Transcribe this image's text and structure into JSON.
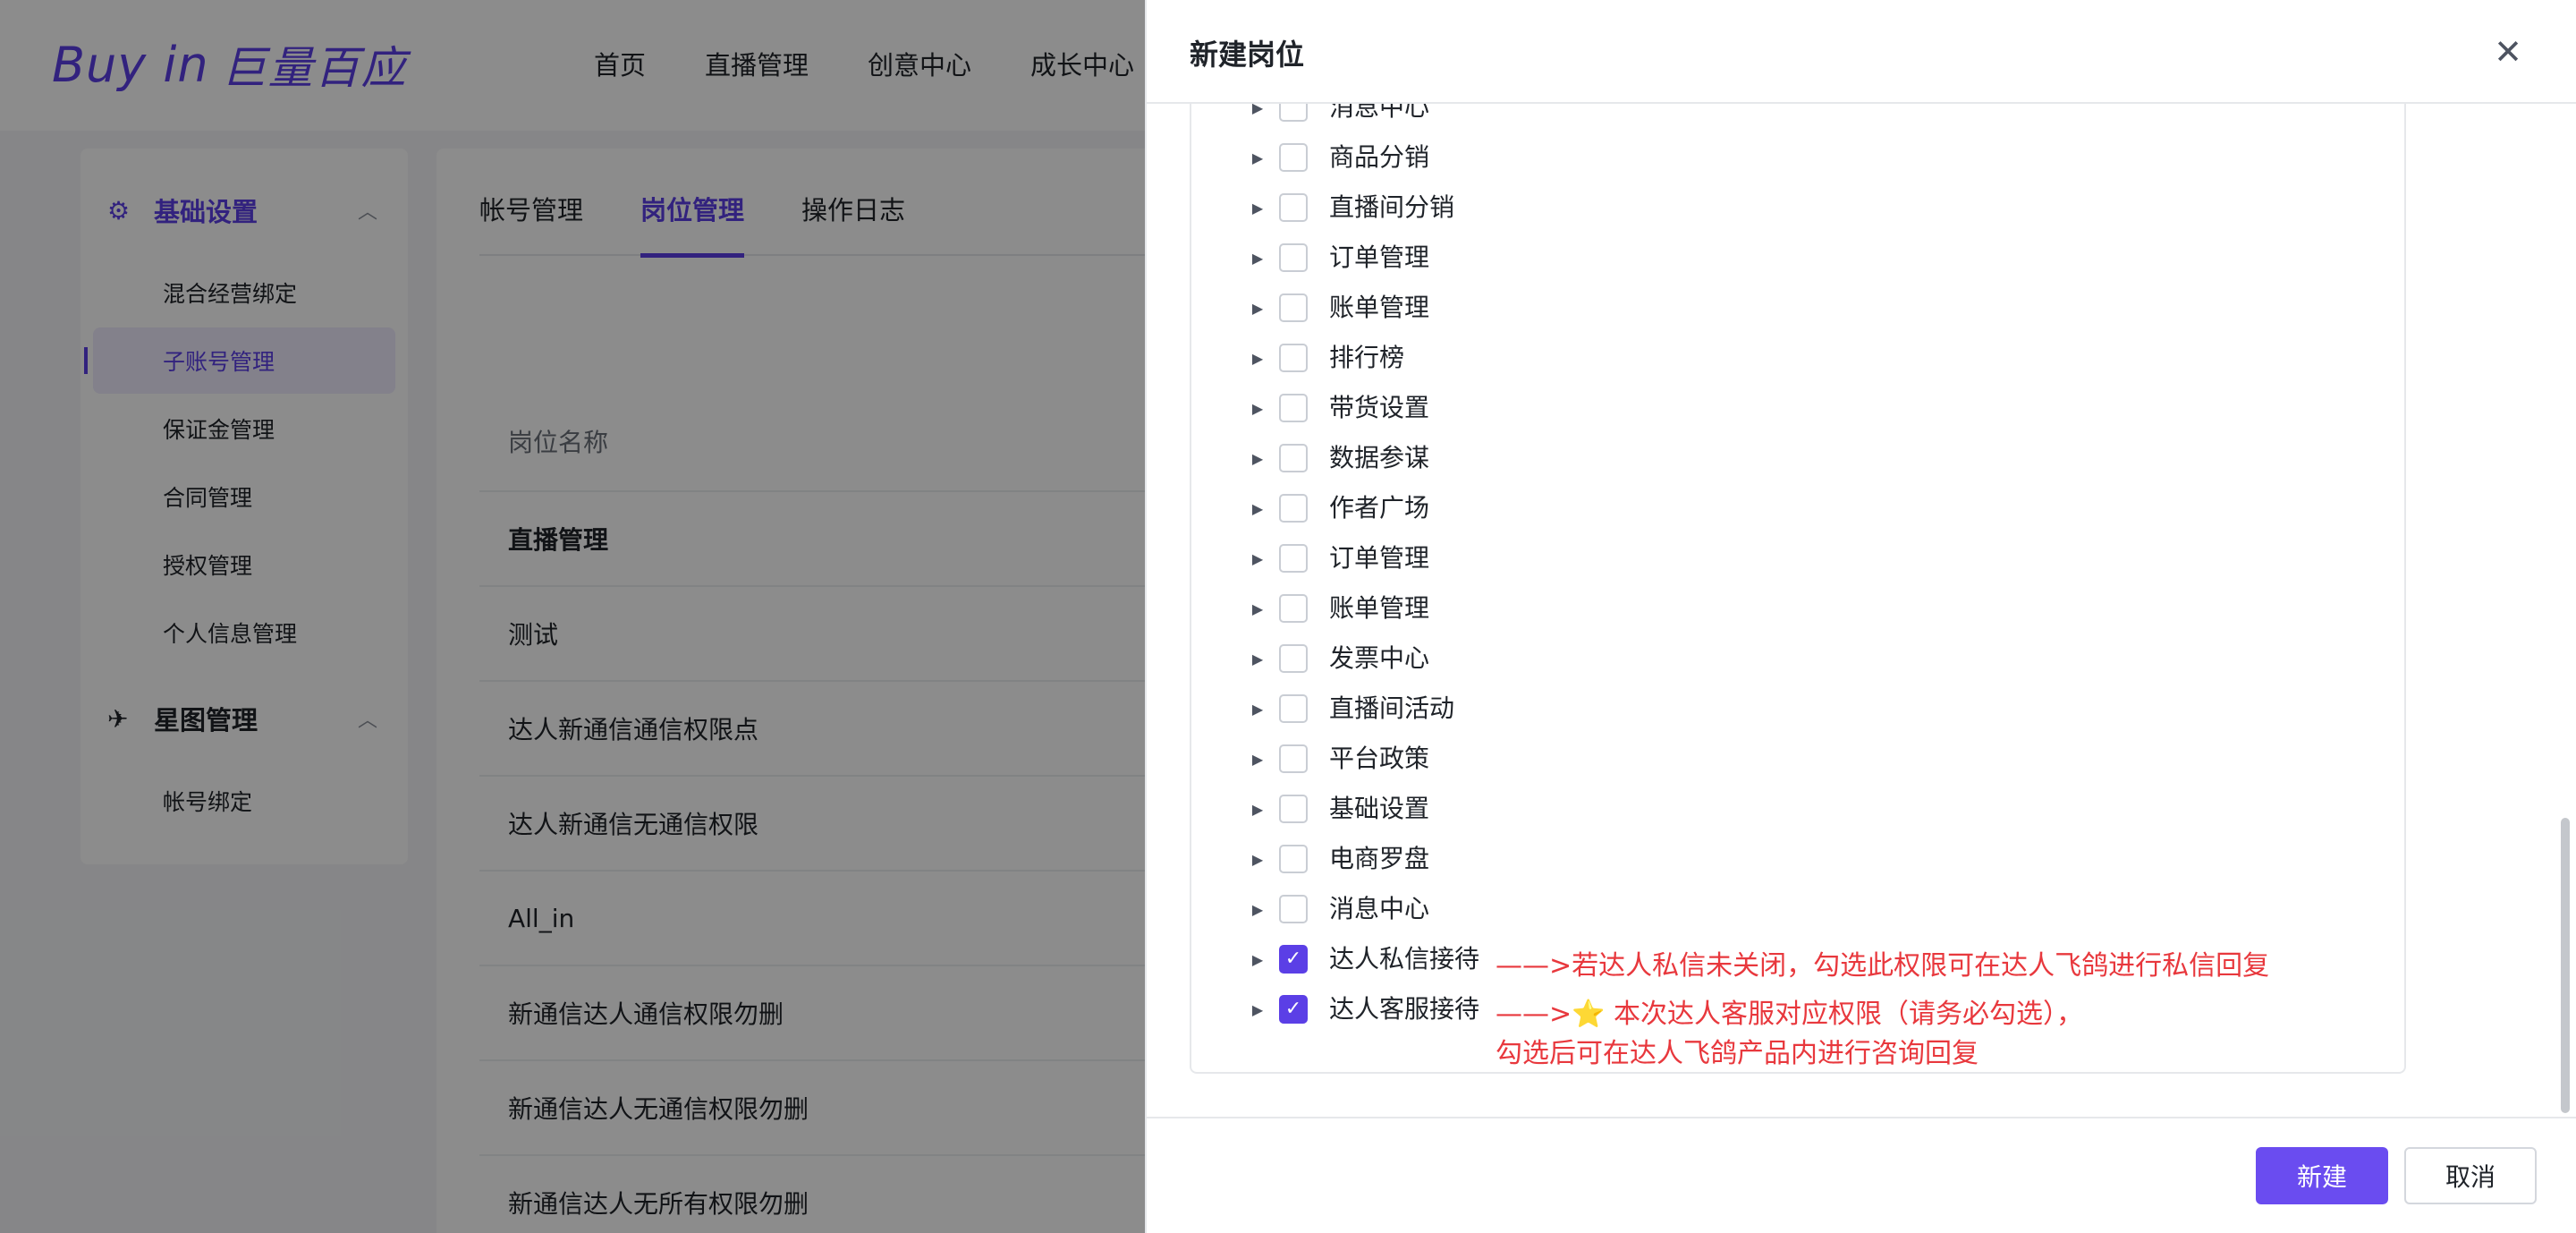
{
  "header": {
    "logo_text": "Buy in",
    "logo_cn": "巨量百应",
    "nav": [
      "首页",
      "直播管理",
      "创意中心",
      "成长中心"
    ]
  },
  "sidebar": {
    "groups": [
      {
        "label": "基础设置",
        "icon": "gear-icon",
        "items": [
          "混合经营绑定",
          "子账号管理",
          "保证金管理",
          "合同管理",
          "授权管理",
          "个人信息管理"
        ]
      },
      {
        "label": "星图管理",
        "icon": "star-map-icon",
        "items": [
          "帐号绑定"
        ]
      }
    ],
    "active_item": "子账号管理"
  },
  "content": {
    "tabs": [
      "帐号管理",
      "岗位管理",
      "操作日志"
    ],
    "active_tab": "岗位管理",
    "table_header": "岗位名称",
    "rows": [
      "直播管理",
      "测试",
      "达人新通信通信权限点",
      "达人新通信无通信权限",
      "All_in",
      "新通信达人通信权限勿删",
      "新通信达人无通信权限勿删",
      "新通信达人无所有权限勿删"
    ]
  },
  "drawer": {
    "title": "新建岗位",
    "permissions": [
      {
        "label": "消息中心",
        "checked": false
      },
      {
        "label": "商品分销",
        "checked": false
      },
      {
        "label": "直播间分销",
        "checked": false
      },
      {
        "label": "订单管理",
        "checked": false
      },
      {
        "label": "账单管理",
        "checked": false
      },
      {
        "label": "排行榜",
        "checked": false
      },
      {
        "label": "带货设置",
        "checked": false
      },
      {
        "label": "数据参谋",
        "checked": false
      },
      {
        "label": "作者广场",
        "checked": false
      },
      {
        "label": "订单管理",
        "checked": false
      },
      {
        "label": "账单管理",
        "checked": false
      },
      {
        "label": "发票中心",
        "checked": false
      },
      {
        "label": "直播间活动",
        "checked": false
      },
      {
        "label": "平台政策",
        "checked": false
      },
      {
        "label": "基础设置",
        "checked": false
      },
      {
        "label": "电商罗盘",
        "checked": false
      },
      {
        "label": "消息中心",
        "checked": false
      },
      {
        "label": "达人私信接待",
        "checked": true
      },
      {
        "label": "达人客服接待",
        "checked": true
      }
    ],
    "notes": {
      "private_msg": "——>若达人私信未关闭，勾选此权限可在达人飞鸽进行私信回复",
      "cs_prefix": "——>",
      "cs_star": "⭐",
      "cs_line1": "本次达人客服对应权限（请务必勾选），",
      "cs_line2": "勾选后可在达人飞鸽产品内进行咨询回复"
    },
    "confirm_label": "新建",
    "cancel_label": "取消"
  }
}
